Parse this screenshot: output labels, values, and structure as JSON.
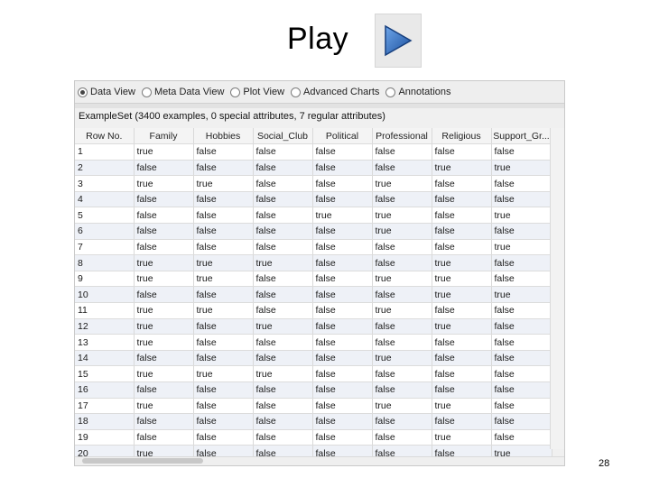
{
  "slide": {
    "title": "Play",
    "page_number": "28"
  },
  "views": [
    {
      "label": "Data View",
      "selected": true
    },
    {
      "label": "Meta Data View",
      "selected": false
    },
    {
      "label": "Plot View",
      "selected": false
    },
    {
      "label": "Advanced Charts",
      "selected": false
    },
    {
      "label": "Annotations",
      "selected": false
    }
  ],
  "example_set_info": "ExampleSet (3400 examples, 0 special attributes, 7 regular attributes)",
  "table": {
    "columns": [
      "Row No.",
      "Family",
      "Hobbies",
      "Social_Club",
      "Political",
      "Professional",
      "Religious",
      "Support_Gr..."
    ],
    "rows": [
      [
        "1",
        "true",
        "false",
        "false",
        "false",
        "false",
        "false",
        "false"
      ],
      [
        "2",
        "false",
        "false",
        "false",
        "false",
        "false",
        "true",
        "true"
      ],
      [
        "3",
        "true",
        "true",
        "false",
        "false",
        "true",
        "false",
        "false"
      ],
      [
        "4",
        "false",
        "false",
        "false",
        "false",
        "false",
        "false",
        "false"
      ],
      [
        "5",
        "false",
        "false",
        "false",
        "true",
        "true",
        "false",
        "true"
      ],
      [
        "6",
        "false",
        "false",
        "false",
        "false",
        "true",
        "false",
        "false"
      ],
      [
        "7",
        "false",
        "false",
        "false",
        "false",
        "false",
        "false",
        "true"
      ],
      [
        "8",
        "true",
        "true",
        "true",
        "false",
        "false",
        "true",
        "false"
      ],
      [
        "9",
        "true",
        "true",
        "false",
        "false",
        "true",
        "true",
        "false"
      ],
      [
        "10",
        "false",
        "false",
        "false",
        "false",
        "false",
        "true",
        "true"
      ],
      [
        "11",
        "true",
        "true",
        "false",
        "false",
        "true",
        "false",
        "false"
      ],
      [
        "12",
        "true",
        "false",
        "true",
        "false",
        "false",
        "true",
        "false"
      ],
      [
        "13",
        "true",
        "false",
        "false",
        "false",
        "false",
        "false",
        "false"
      ],
      [
        "14",
        "false",
        "false",
        "false",
        "false",
        "true",
        "false",
        "false"
      ],
      [
        "15",
        "true",
        "true",
        "true",
        "false",
        "false",
        "false",
        "false"
      ],
      [
        "16",
        "false",
        "false",
        "false",
        "false",
        "false",
        "false",
        "false"
      ],
      [
        "17",
        "true",
        "false",
        "false",
        "false",
        "true",
        "true",
        "false"
      ],
      [
        "18",
        "false",
        "false",
        "false",
        "false",
        "false",
        "false",
        "false"
      ],
      [
        "19",
        "false",
        "false",
        "false",
        "false",
        "false",
        "true",
        "false"
      ],
      [
        "20",
        "true",
        "false",
        "false",
        "false",
        "false",
        "false",
        "true"
      ]
    ]
  },
  "colors": {
    "play_button": "#2f6fc0",
    "row_alt": "#eef1f7"
  },
  "icons": {
    "play": "play-triangle-icon"
  }
}
